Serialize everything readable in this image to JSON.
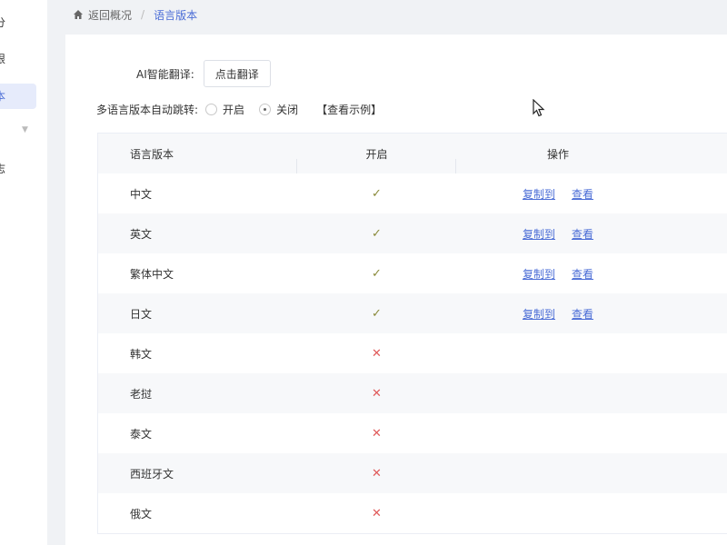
{
  "sidebar": {
    "items": [
      {
        "label": "分"
      },
      {
        "label": "限"
      },
      {
        "label": "本"
      },
      {
        "label": "志"
      }
    ]
  },
  "breadcrumb": {
    "home": "返回概况",
    "sep": "/",
    "current": "语言版本"
  },
  "ai": {
    "label": "AI智能翻译:",
    "button": "点击翻译"
  },
  "autoswitch": {
    "label": "多语言版本自动跳转:",
    "options": [
      "开启",
      "关闭"
    ],
    "selected": "关闭",
    "example": "【查看示例】"
  },
  "table": {
    "headers": [
      "语言版本",
      "开启",
      "操作"
    ],
    "rows": [
      {
        "name": "中文",
        "enabled": true
      },
      {
        "name": "英文",
        "enabled": true
      },
      {
        "name": "繁体中文",
        "enabled": true
      },
      {
        "name": "日文",
        "enabled": true
      },
      {
        "name": "韩文",
        "enabled": false
      },
      {
        "name": "老挝",
        "enabled": false
      },
      {
        "name": "泰文",
        "enabled": false
      },
      {
        "name": "西班牙文",
        "enabled": false
      },
      {
        "name": "俄文",
        "enabled": false
      }
    ],
    "actions": {
      "copy": "复制到",
      "view": "查看"
    }
  },
  "colors": {
    "accent": "#4a6cd6",
    "check": "#8a8a3a",
    "cross": "#e05a5a"
  }
}
